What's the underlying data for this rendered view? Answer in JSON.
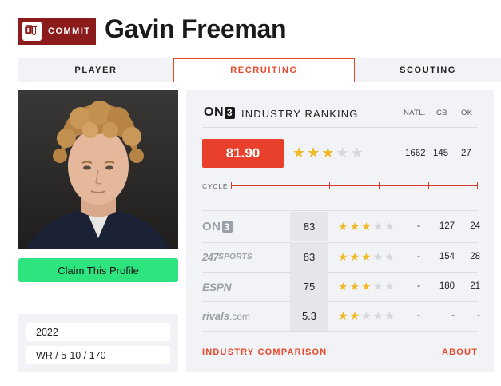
{
  "header": {
    "commit_label": "COMMIT",
    "school_logo_icon": "oklahoma-ou-logo",
    "school_color": "#8c1c1c",
    "player_name": "Gavin Freeman"
  },
  "tabs": [
    {
      "label": "PLAYER",
      "active": false
    },
    {
      "label": "RECRUITING",
      "active": true
    },
    {
      "label": "SCOUTING",
      "active": false
    }
  ],
  "sidebar": {
    "claim_button_label": "Claim This Profile",
    "class_year": "2022",
    "position_size": "WR / 5-10 / 170"
  },
  "industry": {
    "brand_logo": "ON3",
    "title": "INDUSTRY RANKING",
    "columns": [
      "NATL.",
      "CB",
      "OK"
    ],
    "score": "81.90",
    "stars": 3,
    "natl": "1662",
    "cb": "145",
    "ok": "27",
    "cycle_label": "CYCLE"
  },
  "services": [
    {
      "name": "ON3",
      "logo": "on3-logo",
      "rating": "83",
      "stars": 3,
      "natl": "-",
      "cb": "127",
      "ok": "24"
    },
    {
      "name": "247SPORTS",
      "logo": "247sports-logo",
      "rating": "83",
      "stars": 3,
      "natl": "-",
      "cb": "154",
      "ok": "28"
    },
    {
      "name": "ESPN",
      "logo": "espn-logo",
      "rating": "75",
      "stars": 3,
      "natl": "-",
      "cb": "180",
      "ok": "21"
    },
    {
      "name": "rivals.com",
      "logo": "rivals-logo",
      "rating": "5.3",
      "stars": 2,
      "natl": "-",
      "cb": "-",
      "ok": "-"
    }
  ],
  "footer": {
    "comparison_link": "INDUSTRY COMPARISON",
    "about_link": "ABOUT"
  },
  "colors": {
    "accent": "#e8482b",
    "claim_green": "#2ee47f",
    "star_gold": "#f0b928",
    "panel_bg": "#f2f3f6"
  }
}
